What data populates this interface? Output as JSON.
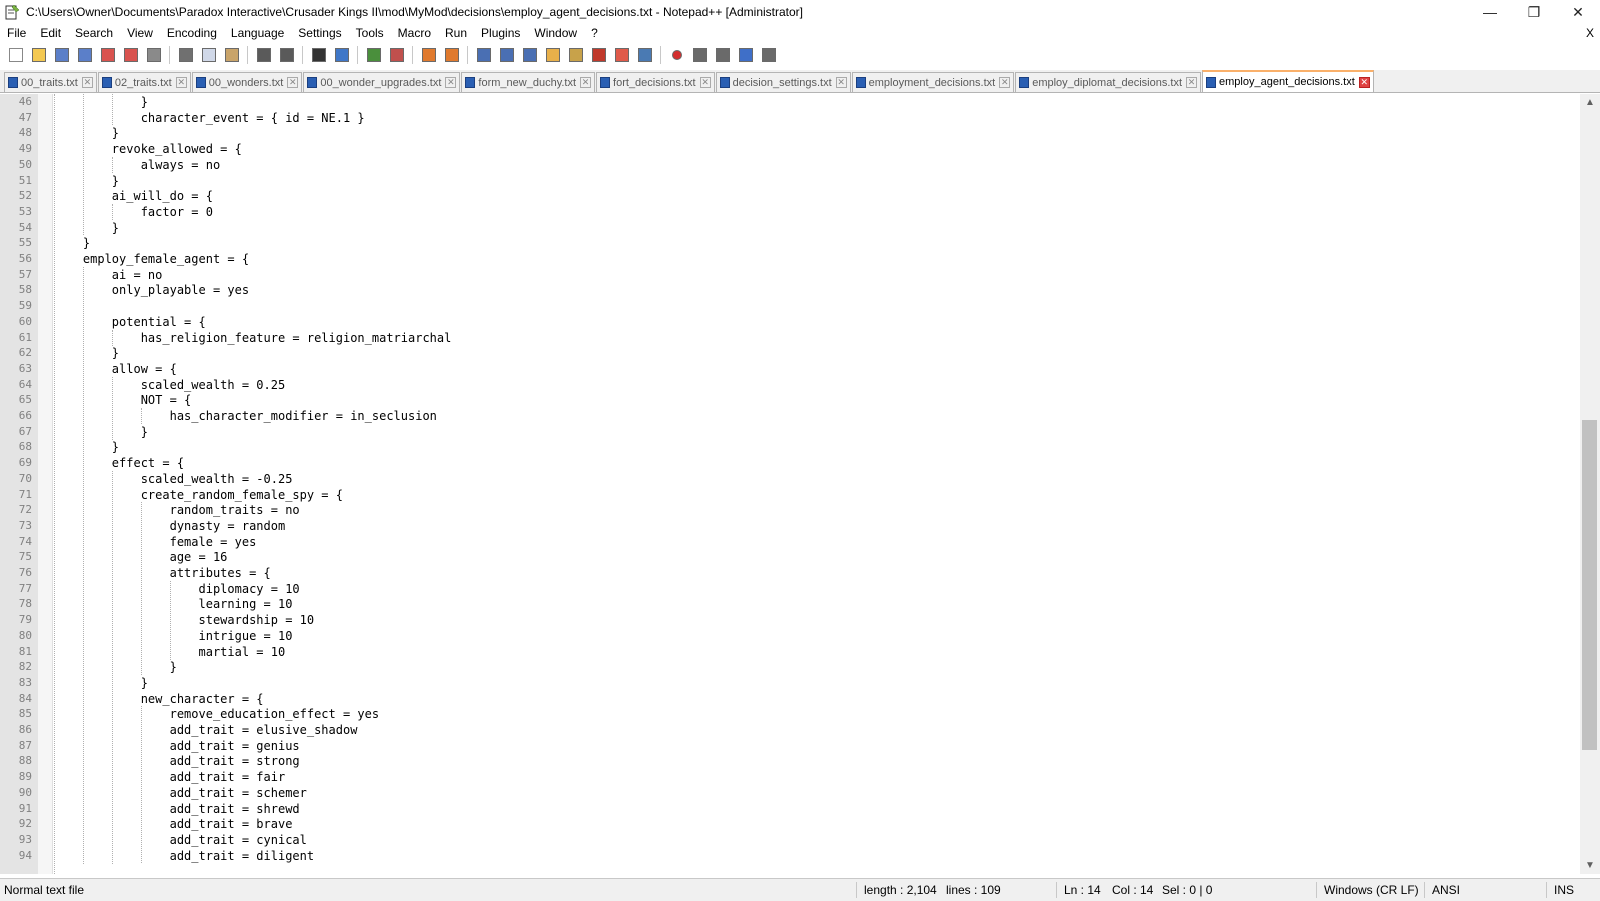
{
  "window": {
    "title": "C:\\Users\\Owner\\Documents\\Paradox Interactive\\Crusader Kings II\\mod\\MyMod\\decisions\\employ_agent_decisions.txt - Notepad++ [Administrator]",
    "minimize_glyph": "—",
    "restore_glyph": "❐",
    "close_glyph": "✕"
  },
  "menu": {
    "items": [
      "File",
      "Edit",
      "Search",
      "View",
      "Encoding",
      "Language",
      "Settings",
      "Tools",
      "Macro",
      "Run",
      "Plugins",
      "Window",
      "?"
    ],
    "close_label": "X"
  },
  "toolbar": {
    "buttons": [
      {
        "name": "new-file-icon",
        "color": "#ffffff"
      },
      {
        "name": "open-file-icon",
        "color": "#f3c851"
      },
      {
        "name": "save-icon",
        "color": "#5b7fc9"
      },
      {
        "name": "save-all-icon",
        "color": "#5b7fc9"
      },
      {
        "name": "close-file-icon",
        "color": "#d9534f"
      },
      {
        "name": "close-all-icon",
        "color": "#d9534f"
      },
      {
        "name": "print-icon",
        "color": "#8a8a8a"
      },
      {
        "name": "sep",
        "color": ""
      },
      {
        "name": "cut-icon",
        "color": "#707070"
      },
      {
        "name": "copy-icon",
        "color": "#d0d8e8"
      },
      {
        "name": "paste-icon",
        "color": "#c9a46a"
      },
      {
        "name": "sep",
        "color": ""
      },
      {
        "name": "undo-icon",
        "color": "#5a5a5a"
      },
      {
        "name": "redo-icon",
        "color": "#5a5a5a"
      },
      {
        "name": "sep",
        "color": ""
      },
      {
        "name": "find-icon",
        "color": "#333333"
      },
      {
        "name": "replace-icon",
        "color": "#3f77c8"
      },
      {
        "name": "sep",
        "color": ""
      },
      {
        "name": "zoom-in-icon",
        "color": "#4a8f3c"
      },
      {
        "name": "zoom-out-icon",
        "color": "#c0504d"
      },
      {
        "name": "sep",
        "color": ""
      },
      {
        "name": "sync-vertical-icon",
        "color": "#e07a2e"
      },
      {
        "name": "sync-horizontal-icon",
        "color": "#e07a2e"
      },
      {
        "name": "sep",
        "color": ""
      },
      {
        "name": "word-wrap-icon",
        "color": "#4a6fb3"
      },
      {
        "name": "show-all-chars-icon",
        "color": "#4a6fb3"
      },
      {
        "name": "indent-guide-icon",
        "color": "#4a6fb3"
      },
      {
        "name": "udl-icon",
        "color": "#e8b04a"
      },
      {
        "name": "doc-map-icon",
        "color": "#c8a24a"
      },
      {
        "name": "function-list-icon",
        "color": "#c0392b"
      },
      {
        "name": "folder-as-workspace-icon",
        "color": "#e05a4a"
      },
      {
        "name": "monitoring-icon",
        "color": "#4a7ab3"
      },
      {
        "name": "sep",
        "color": ""
      },
      {
        "name": "record-macro-icon",
        "color": "#d32f2f"
      },
      {
        "name": "stop-macro-icon",
        "color": "#6a6a6a"
      },
      {
        "name": "play-macro-icon",
        "color": "#6a6a6a"
      },
      {
        "name": "run-macro-multiple-icon",
        "color": "#3f6fc8"
      },
      {
        "name": "save-macro-icon",
        "color": "#6a6a6a"
      }
    ]
  },
  "tabs": [
    {
      "label": "00_traits.txt",
      "active": false
    },
    {
      "label": "02_traits.txt",
      "active": false
    },
    {
      "label": "00_wonders.txt",
      "active": false
    },
    {
      "label": "00_wonder_upgrades.txt",
      "active": false
    },
    {
      "label": "form_new_duchy.txt",
      "active": false
    },
    {
      "label": "fort_decisions.txt",
      "active": false
    },
    {
      "label": "decision_settings.txt",
      "active": false
    },
    {
      "label": "employment_decisions.txt",
      "active": false
    },
    {
      "label": "employ_diplomat_decisions.txt",
      "active": false
    },
    {
      "label": "employ_agent_decisions.txt",
      "active": true
    }
  ],
  "tab_close_glyph": "✕",
  "editor": {
    "lines": [
      {
        "n": "46",
        "text": "            }"
      },
      {
        "n": "47",
        "text": "            character_event = { id = NE.1 }"
      },
      {
        "n": "48",
        "text": "        }"
      },
      {
        "n": "49",
        "text": "        revoke_allowed = {"
      },
      {
        "n": "50",
        "text": "            always = no"
      },
      {
        "n": "51",
        "text": "        }"
      },
      {
        "n": "52",
        "text": "        ai_will_do = {"
      },
      {
        "n": "53",
        "text": "            factor = 0"
      },
      {
        "n": "54",
        "text": "        }"
      },
      {
        "n": "55",
        "text": "    }"
      },
      {
        "n": "56",
        "text": "    employ_female_agent = {"
      },
      {
        "n": "57",
        "text": "        ai = no"
      },
      {
        "n": "58",
        "text": "        only_playable = yes"
      },
      {
        "n": "59",
        "text": ""
      },
      {
        "n": "60",
        "text": "        potential = {"
      },
      {
        "n": "61",
        "text": "            has_religion_feature = religion_matriarchal"
      },
      {
        "n": "62",
        "text": "        }"
      },
      {
        "n": "63",
        "text": "        allow = {"
      },
      {
        "n": "64",
        "text": "            scaled_wealth = 0.25"
      },
      {
        "n": "65",
        "text": "            NOT = {"
      },
      {
        "n": "66",
        "text": "                has_character_modifier = in_seclusion"
      },
      {
        "n": "67",
        "text": "            }"
      },
      {
        "n": "68",
        "text": "        }"
      },
      {
        "n": "69",
        "text": "        effect = {"
      },
      {
        "n": "70",
        "text": "            scaled_wealth = -0.25"
      },
      {
        "n": "71",
        "text": "            create_random_female_spy = {"
      },
      {
        "n": "72",
        "text": "                random_traits = no"
      },
      {
        "n": "73",
        "text": "                dynasty = random"
      },
      {
        "n": "74",
        "text": "                female = yes"
      },
      {
        "n": "75",
        "text": "                age = 16"
      },
      {
        "n": "76",
        "text": "                attributes = {"
      },
      {
        "n": "77",
        "text": "                    diplomacy = 10"
      },
      {
        "n": "78",
        "text": "                    learning = 10"
      },
      {
        "n": "79",
        "text": "                    stewardship = 10"
      },
      {
        "n": "80",
        "text": "                    intrigue = 10"
      },
      {
        "n": "81",
        "text": "                    martial = 10"
      },
      {
        "n": "82",
        "text": "                }"
      },
      {
        "n": "83",
        "text": "            }"
      },
      {
        "n": "84",
        "text": "            new_character = {"
      },
      {
        "n": "85",
        "text": "                remove_education_effect = yes"
      },
      {
        "n": "86",
        "text": "                add_trait = elusive_shadow"
      },
      {
        "n": "87",
        "text": "                add_trait = genius"
      },
      {
        "n": "88",
        "text": "                add_trait = strong"
      },
      {
        "n": "89",
        "text": "                add_trait = fair"
      },
      {
        "n": "90",
        "text": "                add_trait = schemer"
      },
      {
        "n": "91",
        "text": "                add_trait = shrewd"
      },
      {
        "n": "92",
        "text": "                add_trait = brave"
      },
      {
        "n": "93",
        "text": "                add_trait = cynical"
      },
      {
        "n": "94",
        "text": "                add_trait = diligent"
      }
    ]
  },
  "scrollbar": {
    "up_glyph": "▲",
    "down_glyph": "▼"
  },
  "status": {
    "file_type": "Normal text file",
    "length": "length : 2,104",
    "lines": "lines : 109",
    "ln": "Ln : 14",
    "col": "Col : 14",
    "sel": "Sel : 0 | 0",
    "eol": "Windows (CR LF)",
    "encoding": "ANSI",
    "mode": "INS"
  }
}
